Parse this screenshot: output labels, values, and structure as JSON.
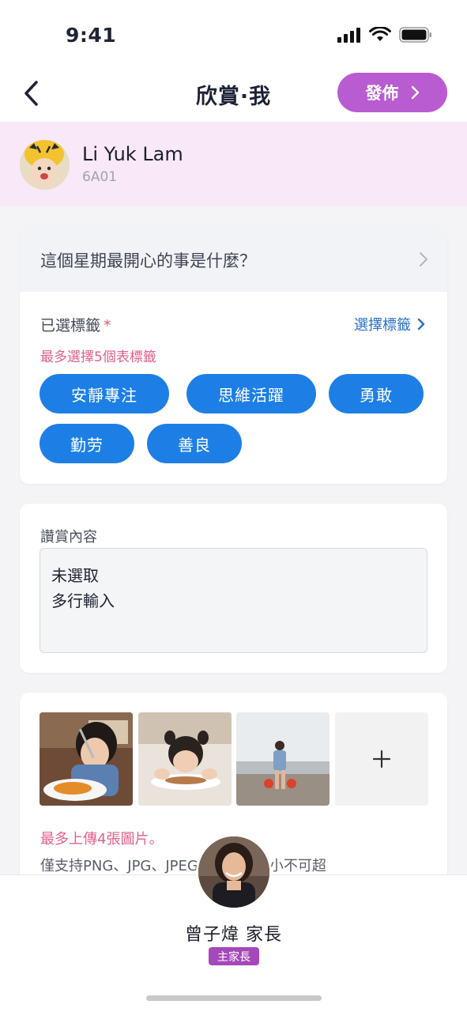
{
  "status_bar": {
    "time": "9:41"
  },
  "nav": {
    "title": "欣賞·我",
    "publish_label": "發佈"
  },
  "student": {
    "name": "Li Yuk Lam",
    "class": "6A01"
  },
  "question": {
    "text": "這個星期最開心的事是什麼？"
  },
  "tags": {
    "label": "已選標籤",
    "required_mark": "*",
    "select_label": "選擇標籤",
    "hint": "最多選擇5個表標籤",
    "items": [
      "安靜專注",
      "思維活躍",
      "勇敢",
      "勤劳",
      "善良"
    ]
  },
  "content": {
    "label": "讚賞內容",
    "value": "未選取\n多行輸入"
  },
  "photos": {
    "hint": "最多上傳4張圖片。",
    "format": "僅支持PNG、JPG、JPEG格式，且大小不可超"
  },
  "parent": {
    "name": "曾子煒 家長",
    "role": "主家長"
  },
  "colors": {
    "accent_purple": "#b95bd1",
    "tag_blue": "#1d7fe6",
    "link_blue": "#2a6fc9",
    "hint_pink": "#e3608a",
    "band_pink": "#f8e8f8"
  }
}
